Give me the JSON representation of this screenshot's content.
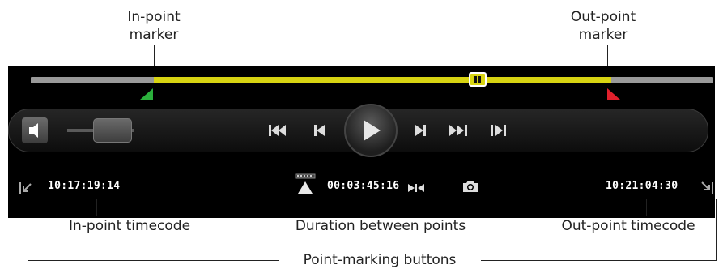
{
  "callouts": {
    "in_marker": [
      "In-point",
      "marker"
    ],
    "out_marker": [
      "Out-point",
      "marker"
    ],
    "in_timecode": "In-point timecode",
    "duration": "Duration between points",
    "out_timecode": "Out-point timecode",
    "point_marking_buttons": "Point-marking buttons"
  },
  "player": {
    "timeline": {
      "in_fraction": 0.18,
      "out_fraction": 0.85,
      "playhead_fraction": 0.655
    },
    "volume_level": 0.8,
    "in_timecode": "10:17:19:14",
    "duration": "00:03:45:16",
    "out_timecode": "10:21:04:30",
    "icons": [
      "speaker-icon",
      "skip-to-start-icon",
      "step-back-icon",
      "play-icon",
      "step-forward-icon",
      "skip-to-end-icon",
      "jump-to-out-icon",
      "set-in-point-icon",
      "set-out-point-icon",
      "go-to-in-icon",
      "snapshot-icon",
      "marker-stack-icon"
    ],
    "colors": {
      "range": "#d8d412",
      "in_marker": "#2bb03c",
      "out_marker": "#e0202c"
    }
  }
}
